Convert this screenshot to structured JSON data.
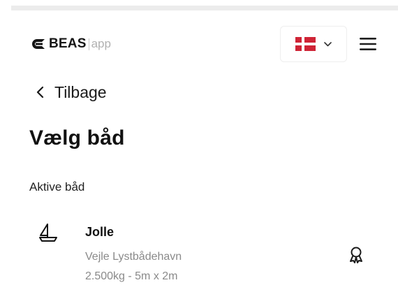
{
  "header": {
    "logo_brand": "BEAS",
    "logo_suffix": "app",
    "language_flag": "denmark-flag",
    "menu_icon": "hamburger-menu-icon"
  },
  "nav": {
    "back_label": "Tilbage"
  },
  "page": {
    "title": "Vælg båd",
    "section_label": "Aktive båd"
  },
  "boats": [
    {
      "icon": "sailboat-icon",
      "name": "Jolle",
      "harbor": "Vejle Lystbådehavn",
      "specs": "2.500kg - 5m x 2m",
      "badge_icon": "award-icon"
    }
  ],
  "colors": {
    "flag_red": "#cf2436",
    "muted_text": "#8a8a8a",
    "logo_app": "#b1b1b1"
  }
}
